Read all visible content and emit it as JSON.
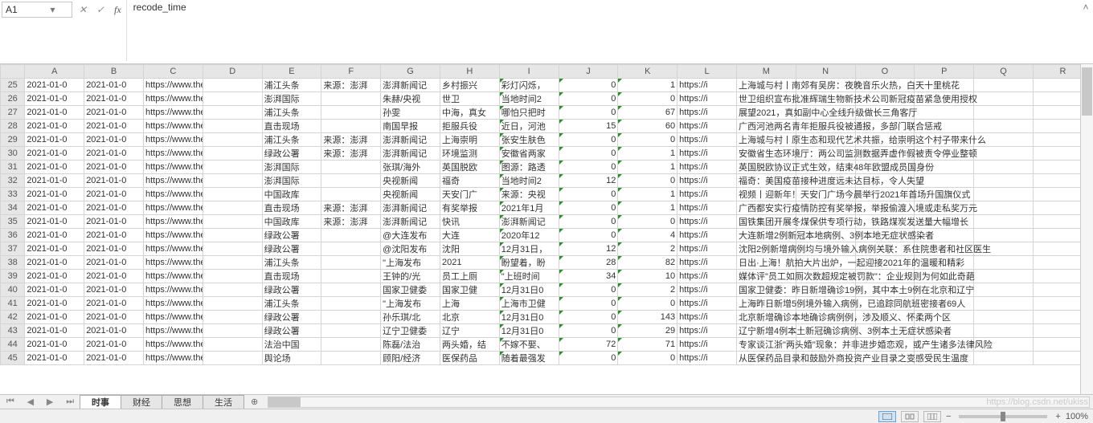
{
  "namebox": "A1",
  "formula": "recode_time",
  "columns": [
    "A",
    "B",
    "C",
    "D",
    "E",
    "F",
    "G",
    "H",
    "I",
    "J",
    "K",
    "L",
    "M",
    "N",
    "O",
    "P",
    "Q",
    "R"
  ],
  "rows": [
    {
      "n": 25,
      "A": "2021-01-0",
      "B": "2021-01-0",
      "C": "https://www.thepap",
      "E": "浦江头条",
      "F": "来源：澎湃",
      "G": "澎湃新闻记",
      "H": "乡村振兴",
      "I": "彩灯闪烁，",
      "J": "0",
      "K": "1",
      "L": "https://i",
      "M": "上海城与村丨南郊有吴房：夜晚音乐火热，白天十里桃花"
    },
    {
      "n": 26,
      "A": "2021-01-0",
      "B": "2021-01-0",
      "C": "https://www.thepap",
      "E": "澎湃国际",
      "G": "朱赫/央视",
      "H": "世卫",
      "I": "当地时间2",
      "J": "0",
      "K": "0",
      "L": "https://i",
      "M": "世卫组织宣布批准辉瑞生物新技术公司新冠疫苗紧急使用授权"
    },
    {
      "n": 27,
      "A": "2021-01-0",
      "B": "2021-01-0",
      "C": "https://www.thepap",
      "E": "浦江头条",
      "G": "孙雯",
      "H": "中海，真女",
      "I": "哪怕只把时",
      "J": "0",
      "K": "67",
      "L": "https://i",
      "M": "展望2021，真如副中心全线升级做长三角客厅"
    },
    {
      "n": 28,
      "A": "2021-01-0",
      "B": "2021-01-0",
      "C": "https://www.thepap",
      "E": "直击现场",
      "G": "南国早报",
      "H": "拒服兵役",
      "I": "近日，河池",
      "J": "15",
      "K": "60",
      "L": "https://i",
      "M": "广西河池两名青年拒服兵役被通报，多部门联合惩戒"
    },
    {
      "n": 29,
      "A": "2021-01-0",
      "B": "2021-01-0",
      "C": "https://www.thepap",
      "E": "浦江头条",
      "F": "来源：澎湃",
      "G": "澎湃新闻记",
      "H": "上海崇明",
      "I": "张安生肤色",
      "J": "0",
      "K": "0",
      "L": "https://i",
      "M": "上海城与村丨原生态和现代艺术共振，给崇明这个村子带来什么"
    },
    {
      "n": 30,
      "A": "2021-01-0",
      "B": "2021-01-0",
      "C": "https://www.thepap",
      "E": "绿政公署",
      "F": "来源：澎湃",
      "G": "澎湃新闻记",
      "H": "环境监测",
      "I": "安徽省两家",
      "J": "0",
      "K": "1",
      "L": "https://i",
      "M": "安徽省生态环境厅：两公司监测数据弄虚作假被责令停业整顿"
    },
    {
      "n": 31,
      "A": "2021-01-0",
      "B": "2021-01-0",
      "C": "https://www.thepap",
      "E": "澎湃国际",
      "G": "张琪/海外",
      "H": "英国脱欧",
      "I": "图源：路透",
      "J": "0",
      "K": "1",
      "L": "https://i",
      "M": "英国脱欧协议正式生效，结束48年欧盟成员国身份"
    },
    {
      "n": 32,
      "A": "2021-01-0",
      "B": "2021-01-0",
      "C": "https://www.thepap",
      "E": "澎湃国际",
      "G": "央视新闻",
      "H": "福奇",
      "I": "当地时间2",
      "J": "12",
      "K": "0",
      "L": "https://i",
      "M": "福奇：美国疫苗接种进度远未达目标，令人失望"
    },
    {
      "n": 33,
      "A": "2021-01-0",
      "B": "2021-01-0",
      "C": "https://www.thepap",
      "E": "中国政库",
      "G": "央视新闻",
      "H": "天安门广",
      "I": "来源：央视",
      "J": "0",
      "K": "1",
      "L": "https://i",
      "M": "视频丨迎新年！天安门广场今晨举行2021年首场升国旗仪式"
    },
    {
      "n": 34,
      "A": "2021-01-0",
      "B": "2021-01-0",
      "C": "https://www.thepap",
      "E": "直击现场",
      "F": "来源：澎湃",
      "G": "澎湃新闻记",
      "H": "有奖举报",
      "I": "2021年1月",
      "J": "0",
      "K": "1",
      "L": "https://i",
      "M": "广西都安实行疫情防控有奖举报，举报偷渡入境或走私奖万元"
    },
    {
      "n": 35,
      "A": "2021-01-0",
      "B": "2021-01-0",
      "C": "https://www.thepap",
      "E": "中国政库",
      "F": "来源：澎湃",
      "G": "澎湃新闻记",
      "H": "快讯",
      "I": "澎湃新闻记",
      "J": "0",
      "K": "0",
      "L": "https://i",
      "M": "国铁集团开展冬煤保供专项行动，铁路煤炭发送量大幅增长"
    },
    {
      "n": 36,
      "A": "2021-01-0",
      "B": "2021-01-0",
      "C": "https://www.thepap",
      "E": "绿政公署",
      "G": "@大连发布",
      "H": "大连",
      "I": "2020年12",
      "J": "0",
      "K": "4",
      "L": "https://i",
      "M": "大连新增2例新冠本地病例、3例本地无症状感染者"
    },
    {
      "n": 37,
      "A": "2021-01-0",
      "B": "2021-01-0",
      "C": "https://www.thepap",
      "E": "绿政公署",
      "G": "@沈阳发布",
      "H": "沈阳",
      "I": "12月31日，",
      "J": "12",
      "K": "2",
      "L": "https://i",
      "M": "沈阳2例新增病例均与境外输入病例关联：系住院患者和社区医生"
    },
    {
      "n": 38,
      "A": "2021-01-0",
      "B": "2021-01-0",
      "C": "https://www.thepap",
      "E": "浦江头条",
      "G": "\"上海发布",
      "H": "2021",
      "I": "盼望着，盼",
      "J": "28",
      "K": "82",
      "L": "https://i",
      "M": "日出·上海！航拍大片出炉，一起迎接2021年的温暖和精彩"
    },
    {
      "n": 39,
      "A": "2021-01-0",
      "B": "2021-01-0",
      "C": "https://www.thepap",
      "E": "直击现场",
      "G": "王钟的/光",
      "H": "员工上厕",
      "I": "\"上班时间",
      "J": "34",
      "K": "10",
      "L": "https://i",
      "M": "媒体评\"员工如厕次数超规定被罚款\"：企业规则为何如此奇葩"
    },
    {
      "n": 40,
      "A": "2021-01-0",
      "B": "2021-01-0",
      "C": "https://www.thepap",
      "E": "绿政公署",
      "G": "国家卫健委",
      "H": "国家卫健",
      "I": "12月31日0",
      "J": "0",
      "K": "2",
      "L": "https://i",
      "M": "国家卫健委：昨日新增确诊19例，其中本土9例在北京和辽宁"
    },
    {
      "n": 41,
      "A": "2021-01-0",
      "B": "2021-01-0",
      "C": "https://www.thepap",
      "E": "浦江头条",
      "G": "\"上海发布",
      "H": "上海",
      "I": "上海市卫健",
      "J": "0",
      "K": "0",
      "L": "https://i",
      "M": "上海昨日新增5例境外输入病例，已追踪同航班密接者69人"
    },
    {
      "n": 42,
      "A": "2021-01-0",
      "B": "2021-01-0",
      "C": "https://www.thepap",
      "E": "绿政公署",
      "G": "孙乐琪/北",
      "H": "北京",
      "I": "12月31日0",
      "J": "0",
      "K": "143",
      "L": "https://i",
      "M": "北京新增确诊本地确诊病例例，涉及顺义、怀柔两个区"
    },
    {
      "n": 43,
      "A": "2021-01-0",
      "B": "2021-01-0",
      "C": "https://www.thepap",
      "E": "绿政公署",
      "G": "辽宁卫健委",
      "H": "辽宁",
      "I": "12月31日0",
      "J": "0",
      "K": "29",
      "L": "https://i",
      "M": "辽宁新增4例本土新冠确诊病例、3例本土无症状感染者"
    },
    {
      "n": 44,
      "A": "2021-01-0",
      "B": "2021-01-0",
      "C": "https://www.thepap",
      "E": "法治中国",
      "G": "陈磊/法治",
      "H": "两头婚，结",
      "I": "不嫁不娶、",
      "J": "72",
      "K": "71",
      "L": "https://i",
      "M": "专家谈江浙\"两头婚\"现象：并非进步婚恋观，或产生诸多法律风险"
    },
    {
      "n": 45,
      "A": "2021-01-0",
      "B": "2021-01-0",
      "C": "https://www.thepap",
      "E": "舆论场",
      "G": "顾阳/经济",
      "H": "医保药品",
      "I": "随着最强发",
      "J": "0",
      "K": "0",
      "L": "https://i",
      "M": "从医保药品目录和鼓励外商投资产业目录之变感受民生温度"
    }
  ],
  "tabs": [
    "时事",
    "财经",
    "思想",
    "生活"
  ],
  "active_tab": 0,
  "zoom": "100%",
  "watermark": "https://blog.csdn.net/ukiss"
}
